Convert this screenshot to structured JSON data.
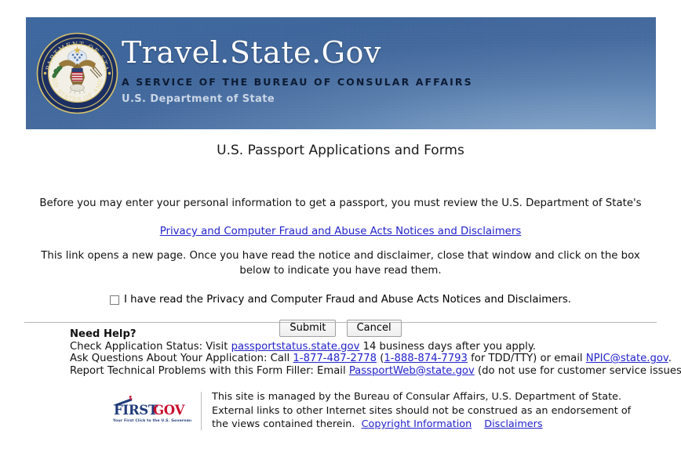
{
  "banner": {
    "seal_alt": "U.S. Department of State seal",
    "title": "Travel.State.Gov",
    "tagline": "A SERVICE OF THE BUREAU OF CONSULAR AFFAIRS",
    "agency": "U.S. Department of State",
    "colors": {
      "gradient_top": "#39659d",
      "gradient_bottom": "#5c84b4",
      "tagline_color": "#0d1b33",
      "agency_color": "#c9d6e6"
    }
  },
  "page": {
    "title": "U.S. Passport Applications and Forms"
  },
  "main": {
    "intro": "Before you may enter your personal information to get a passport, you must review the U.S. Department of State's",
    "privacy_link": "Privacy and Computer Fraud and Abuse Acts Notices and Disclaimers",
    "instructions": "This link opens a new page. Once you have read the notice and disclaimer, close that window and click on the box below to indicate you have read them.",
    "consent_label": "I have read the Privacy and Computer Fraud and Abuse Acts Notices and Disclaimers.",
    "consent_checked": false,
    "submit_label": "Submit",
    "cancel_label": "Cancel",
    "link_color": "#2222cc"
  },
  "help": {
    "heading": "Need Help?",
    "status_prefix": "Check Application Status: Visit ",
    "status_link": "passportstatus.state.gov",
    "status_suffix": " 14 business days after you apply.",
    "questions_prefix": "Ask Questions About Your Application: Call ",
    "phone_main": "1-877-487-2778",
    "phone_open_paren": " (",
    "phone_tdd": "1-888-874-7793",
    "phone_tdd_suffix": " for TDD/TTY) or email ",
    "email_npic": "NPIC@state.gov",
    "questions_end": ".",
    "technical_prefix": "Report Technical Problems with this Form Filler: Email ",
    "email_passportweb": "PassportWeb@state.gov",
    "technical_suffix": " (do not use for customer service issues)."
  },
  "footer": {
    "logo_first": "FIRST",
    "logo_gov": "GOV",
    "logo_tagline": "Your First Click to the U.S. Government",
    "line1": "This site is managed by the Bureau of Consular Affairs, U.S. Department of State.",
    "line2": "External links to other Internet sites should not be construed as an endorsement of",
    "line3_prefix": "the views contained therein.",
    "copyright_link": "Copyright Information",
    "disclaimers_link": "Disclaimers"
  }
}
